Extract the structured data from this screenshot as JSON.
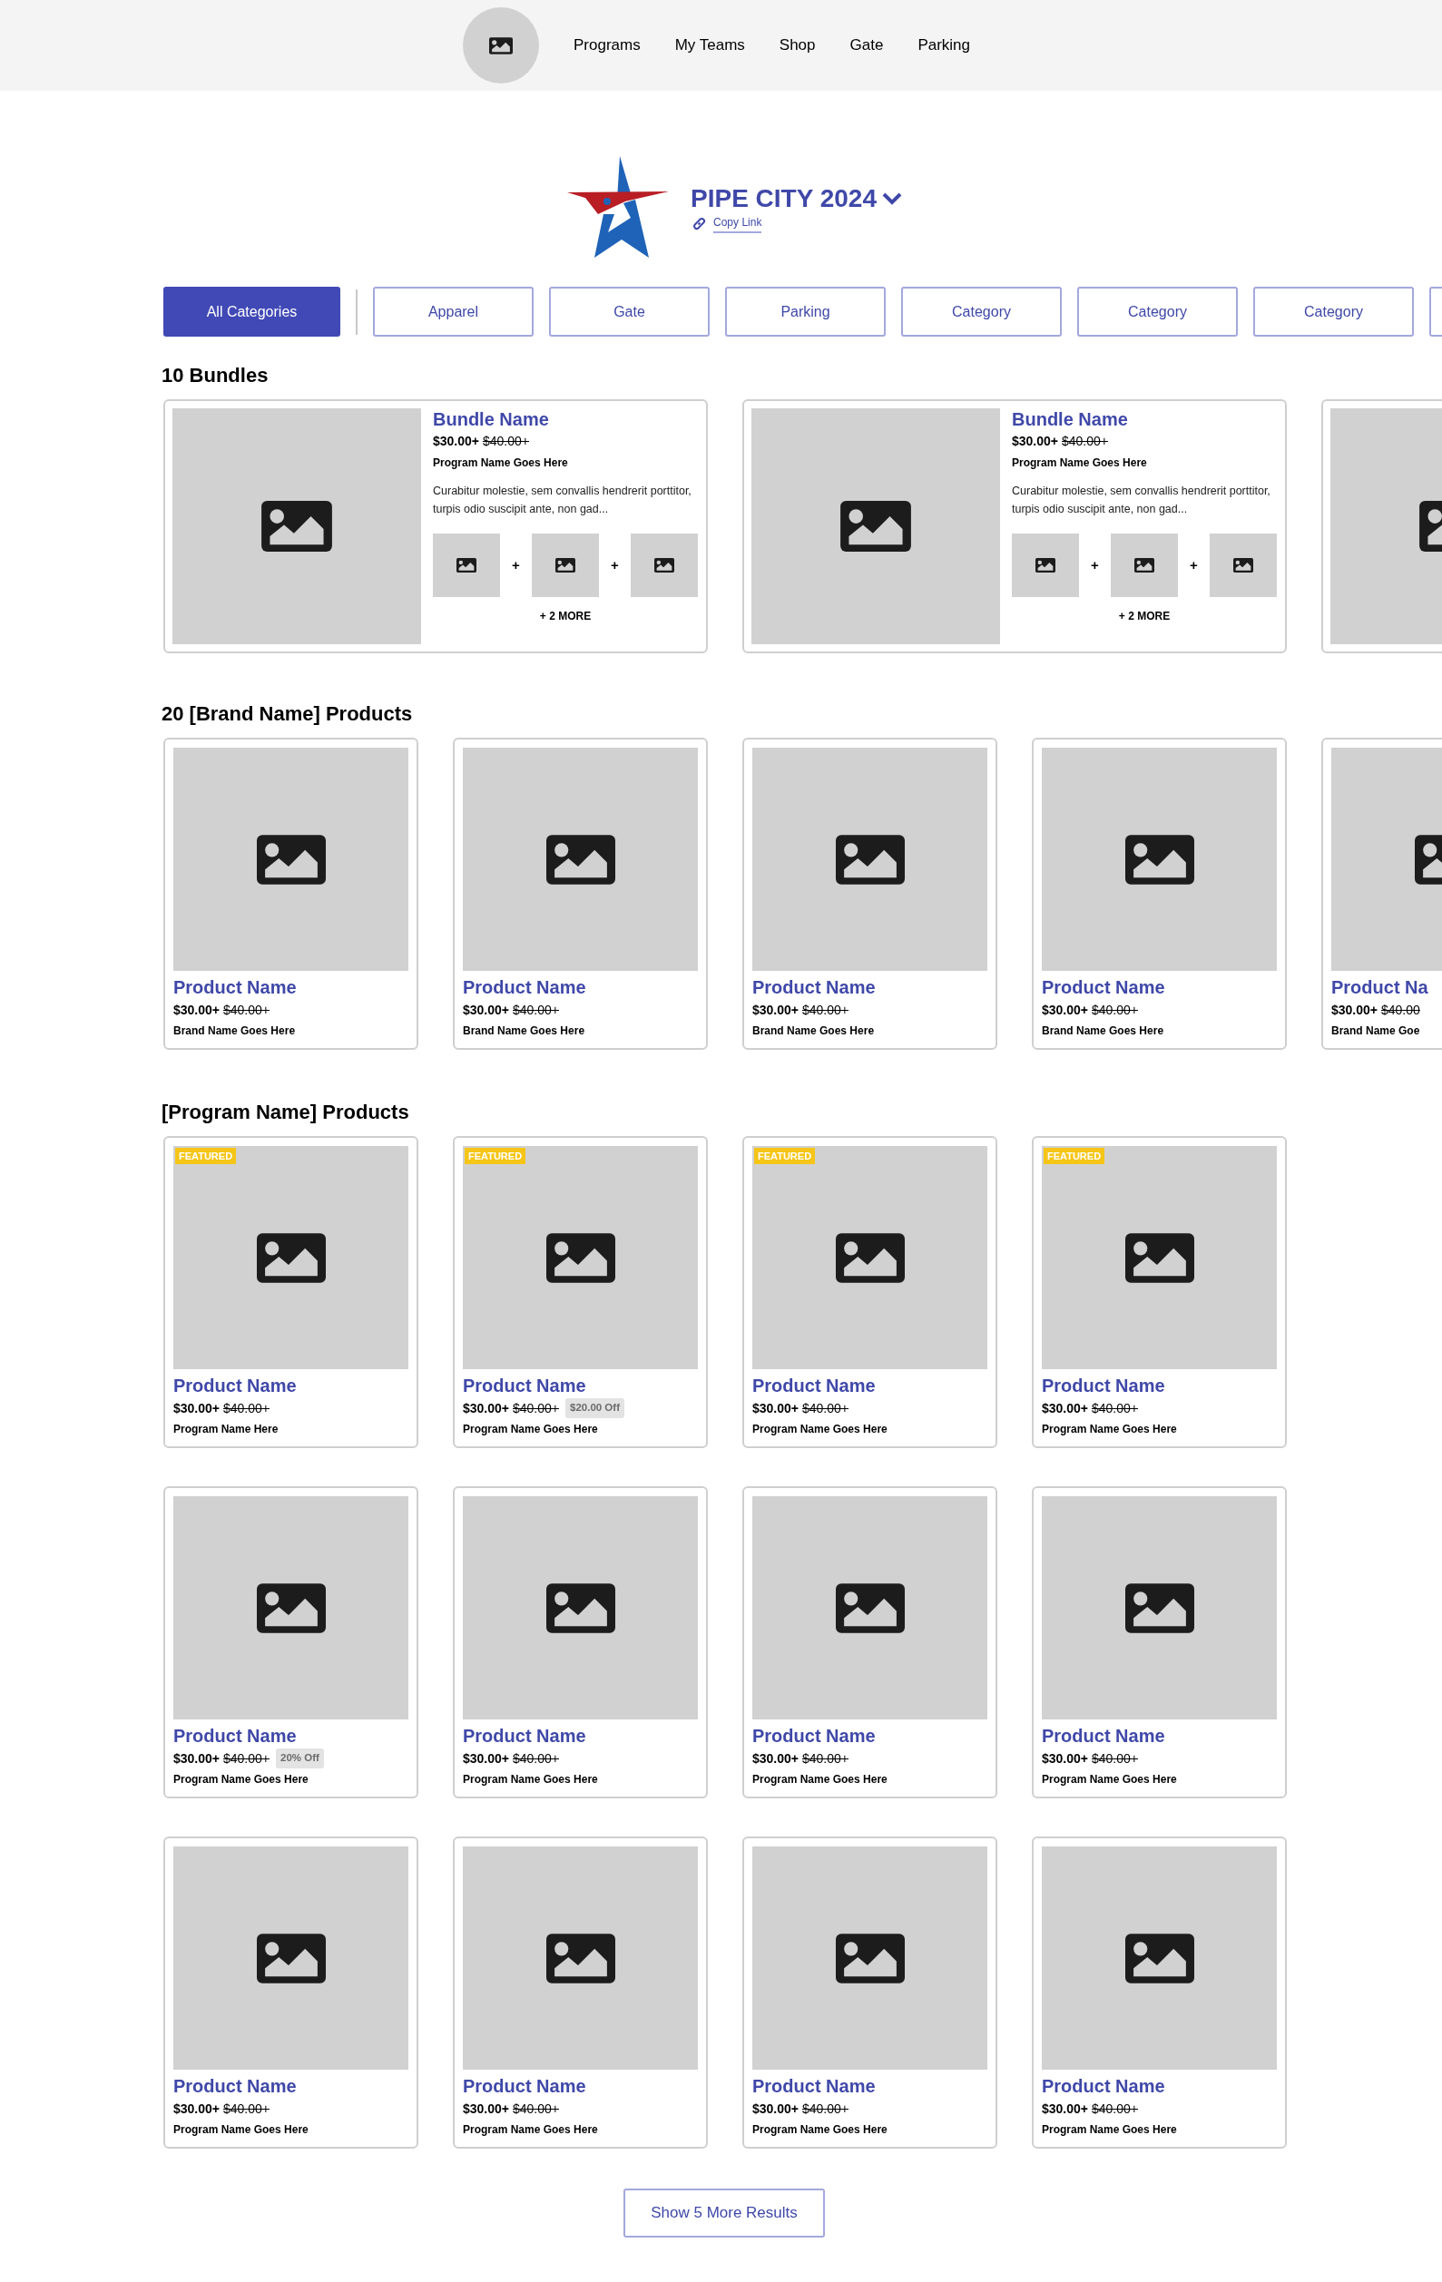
{
  "nav": {
    "items": [
      "Programs",
      "My Teams",
      "Shop",
      "Gate",
      "Parking"
    ]
  },
  "event": {
    "title": "PIPE CITY 2024",
    "copy_link": "Copy Link"
  },
  "categories": [
    {
      "label": "All Categories",
      "selected": true
    },
    {
      "label": "Apparel",
      "selected": false
    },
    {
      "label": "Gate",
      "selected": false
    },
    {
      "label": "Parking",
      "selected": false
    },
    {
      "label": "Category",
      "selected": false
    },
    {
      "label": "Category",
      "selected": false
    },
    {
      "label": "Category",
      "selected": false
    },
    {
      "selected": false
    }
  ],
  "bundles": {
    "heading": "10 Bundles",
    "items": [
      {
        "kind": "full",
        "name": "Bundle Name",
        "price": "$30.00+",
        "old_price": "$40.00+",
        "program": "Program Name Goes Here",
        "description": "Curabitur molestie, sem convallis hendrerit porttitor, turpis odio suscipit ante, non gad...",
        "more": "+ 2 MORE",
        "joiners": [
          "+",
          "+"
        ]
      },
      {
        "kind": "full",
        "name": "Bundle Name",
        "price": "$30.00+",
        "old_price": "$40.00+",
        "program": "Program Name Goes Here",
        "description": "Curabitur molestie, sem convallis hendrerit porttitor, turpis odio suscipit ante, non gad...",
        "more": "+ 2 MORE",
        "joiners": [
          "+",
          "+"
        ]
      },
      {
        "kind": "cut"
      }
    ]
  },
  "brand_products": {
    "heading": "20 [Brand Name] Products",
    "items": [
      {
        "name": "Product Name",
        "price": "$30.00+",
        "old_price": "$40.00+",
        "subtitle": "Brand Name Goes Here"
      },
      {
        "name": "Product Name",
        "price": "$30.00+",
        "old_price": "$40.00+",
        "subtitle": "Brand Name Goes Here"
      },
      {
        "name": "Product Name",
        "price": "$30.00+",
        "old_price": "$40.00+",
        "subtitle": "Brand Name Goes Here"
      },
      {
        "name": "Product Name",
        "price": "$30.00+",
        "old_price": "$40.00+",
        "subtitle": "Brand Name Goes Here"
      },
      {
        "name": "Product Na",
        "price": "$30.00+",
        "old_price": "$40.00",
        "subtitle": "Brand Name Goe"
      }
    ]
  },
  "program_products": {
    "heading": "[Program Name] Products",
    "items": [
      {
        "name": "Product Name",
        "price": "$30.00+",
        "old_price": "$40.00+",
        "subtitle": "Program Name Here",
        "featured": "FEATURED"
      },
      {
        "name": "Product Name",
        "price": "$30.00+",
        "old_price": "$40.00+",
        "discount": "$20.00 Off",
        "subtitle": "Program Name Goes Here",
        "featured": "FEATURED"
      },
      {
        "name": "Product Name",
        "price": "$30.00+",
        "old_price": "$40.00+",
        "subtitle": "Program Name Goes Here",
        "featured": "FEATURED"
      },
      {
        "name": "Product Name",
        "price": "$30.00+",
        "old_price": "$40.00+",
        "subtitle": "Program Name Goes Here",
        "featured": "FEATURED"
      },
      {
        "name": "Product Name",
        "price": "$30.00+",
        "old_price": "$40.00+",
        "discount": "20% Off",
        "subtitle": "Program Name Goes Here"
      },
      {
        "name": "Product Name",
        "price": "$30.00+",
        "old_price": "$40.00+",
        "subtitle": "Program Name Goes Here"
      },
      {
        "name": "Product Name",
        "price": "$30.00+",
        "old_price": "$40.00+",
        "subtitle": "Program Name Goes Here"
      },
      {
        "name": "Product Name",
        "price": "$30.00+",
        "old_price": "$40.00+",
        "subtitle": "Program Name Goes Here"
      },
      {
        "name": "Product Name",
        "price": "$30.00+",
        "old_price": "$40.00+",
        "subtitle": "Program Name Goes Here"
      },
      {
        "name": "Product Name",
        "price": "$30.00+",
        "old_price": "$40.00+",
        "subtitle": "Program Name Goes Here"
      },
      {
        "name": "Product Name",
        "price": "$30.00+",
        "old_price": "$40.00+",
        "subtitle": "Program Name Goes Here"
      },
      {
        "name": "Product Name",
        "price": "$30.00+",
        "old_price": "$40.00+",
        "subtitle": "Program Name Goes Here"
      }
    ]
  },
  "show_more": "Show 5 More Results"
}
